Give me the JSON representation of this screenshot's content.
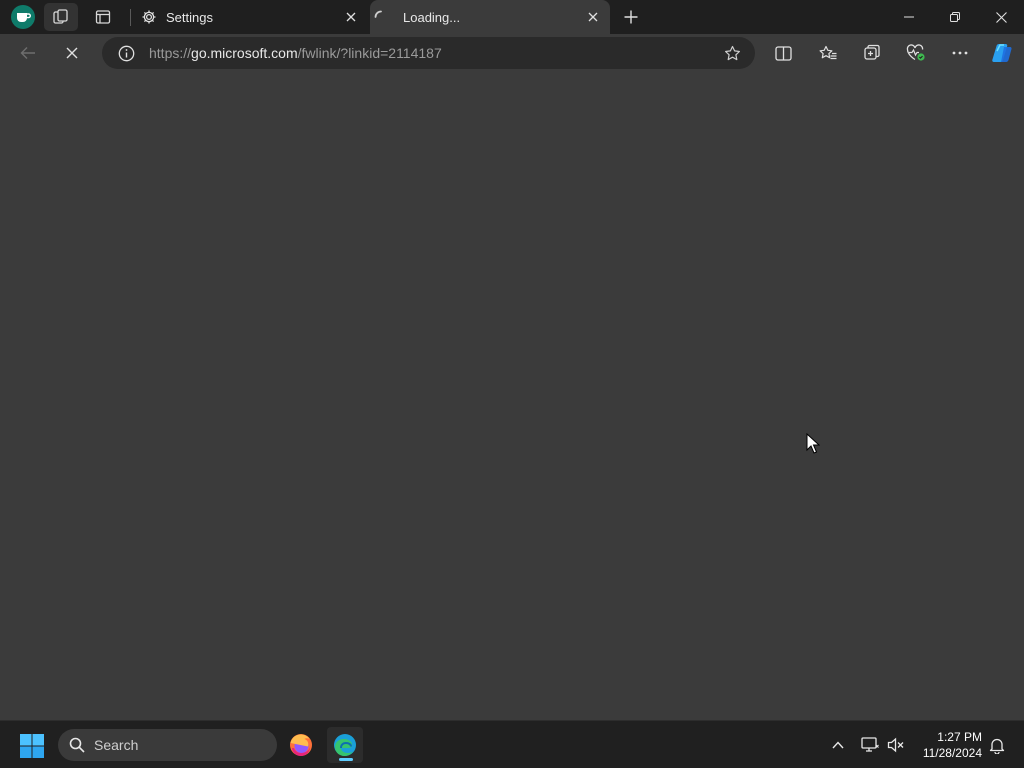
{
  "browser": {
    "tabs": [
      {
        "title": "Settings",
        "icon": "gear-icon",
        "active": false
      },
      {
        "title": "Loading...",
        "icon": "loading-spinner-icon",
        "active": true
      }
    ],
    "address": {
      "prefix": "https://",
      "host": "go.microsoft.com",
      "path": "/fwlink/?linkid=2114187"
    }
  },
  "taskbar": {
    "search_label": "Search",
    "time": "1:27 PM",
    "date": "11/28/2024"
  },
  "colors": {
    "page_bg": "#3b3b3b",
    "titlebar_bg": "#1f1f1f",
    "taskbar_bg": "#202020",
    "accent": "#60cdff"
  }
}
